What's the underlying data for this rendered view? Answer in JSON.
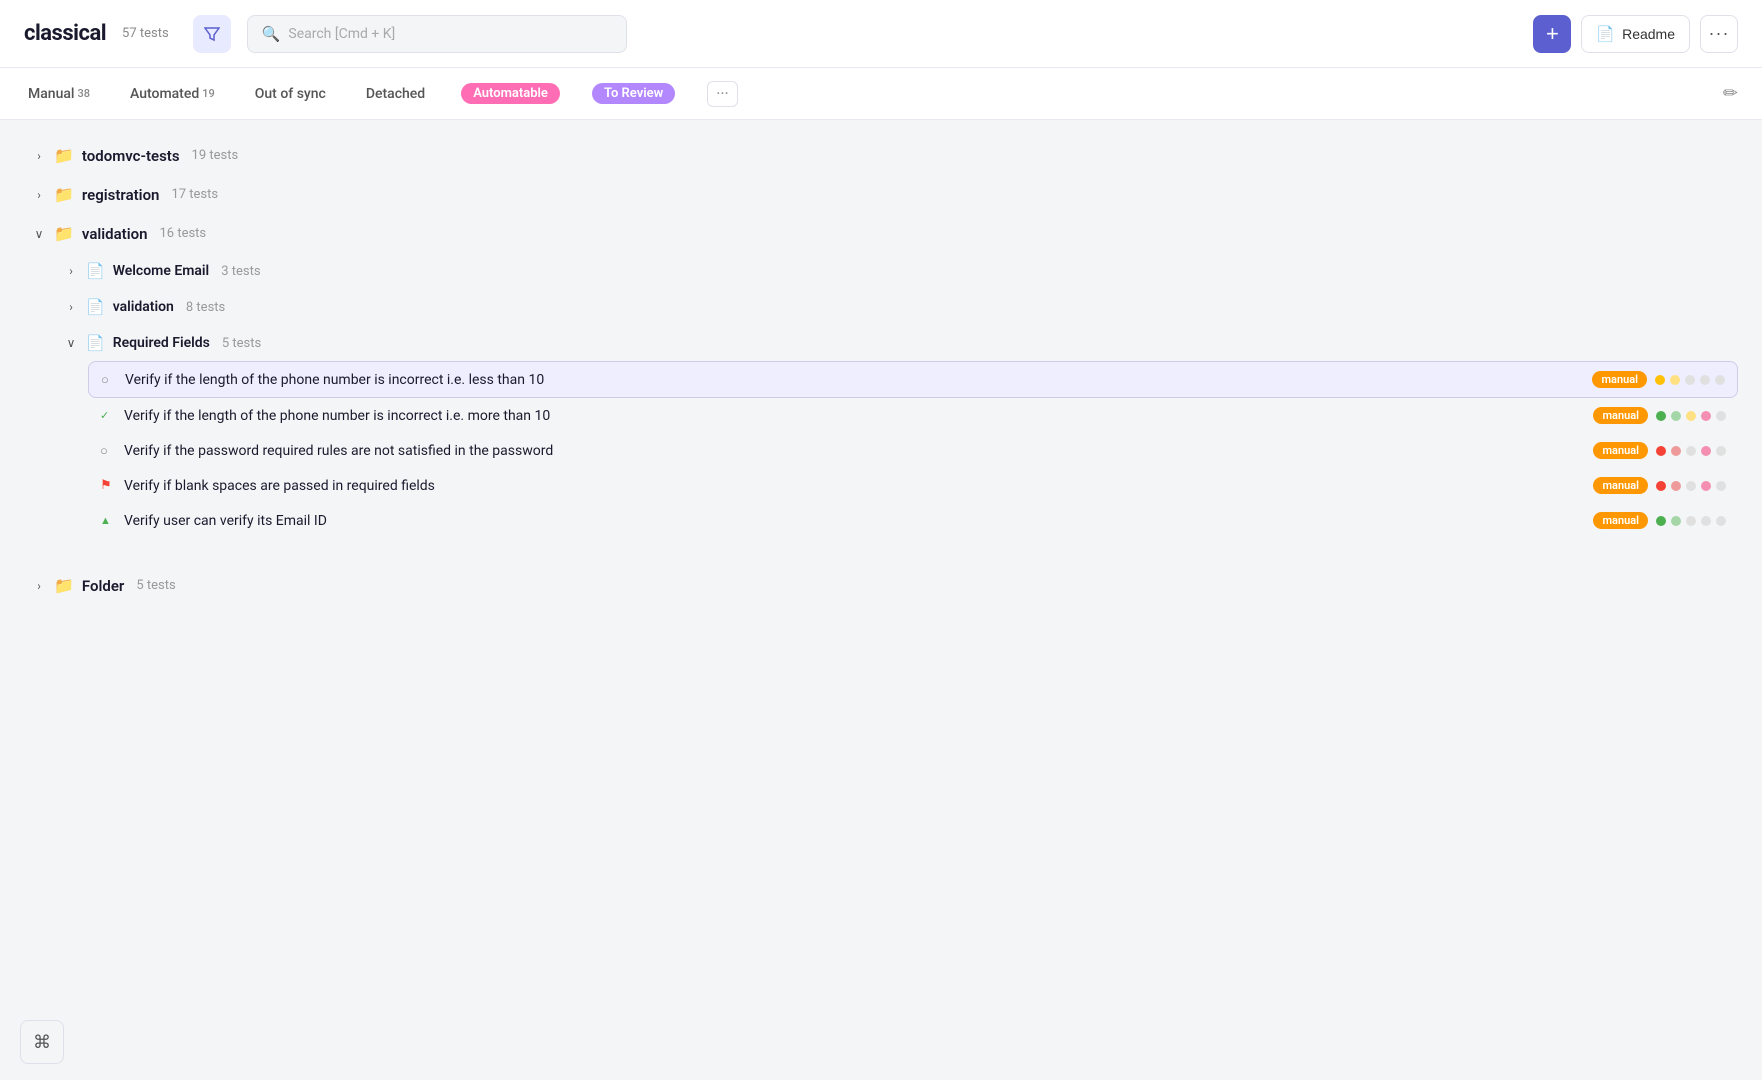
{
  "header": {
    "logo": "classical",
    "tests_count": "57 tests",
    "filter_label": "filter",
    "search_placeholder": "Search [Cmd + K]",
    "add_label": "+",
    "readme_label": "Readme",
    "more_label": "···"
  },
  "tabs": {
    "items": [
      {
        "id": "manual",
        "label": "Manual",
        "count": "38"
      },
      {
        "id": "automated",
        "label": "Automated",
        "count": "19"
      },
      {
        "id": "out-of-sync",
        "label": "Out of sync",
        "count": ""
      },
      {
        "id": "detached",
        "label": "Detached",
        "count": ""
      },
      {
        "id": "automatable",
        "label": "Automatable",
        "badge": "pink"
      },
      {
        "id": "to-review",
        "label": "To Review",
        "badge": "purple"
      },
      {
        "id": "more",
        "label": "···"
      }
    ],
    "edit_icon": "✏"
  },
  "folders": [
    {
      "id": "todomvc-tests",
      "name": "todomvc-tests",
      "count": "19 tests",
      "expanded": false
    },
    {
      "id": "registration",
      "name": "registration",
      "count": "17 tests",
      "expanded": false
    },
    {
      "id": "validation",
      "name": "validation",
      "count": "16 tests",
      "expanded": true,
      "subfolders": [
        {
          "id": "welcome-email",
          "name": "Welcome Email",
          "count": "3 tests",
          "expanded": false
        },
        {
          "id": "validation-sub",
          "name": "validation",
          "count": "8 tests",
          "expanded": false
        },
        {
          "id": "required-fields",
          "name": "Required Fields",
          "count": "5 tests",
          "expanded": true,
          "tests": [
            {
              "id": "t1",
              "name": "Verify if the length of the phone number is incorrect i.e. less than 10",
              "badge": "manual",
              "status_icon": "○",
              "status_color": "#888",
              "selected": true,
              "dots": [
                {
                  "color": "yellow"
                },
                {
                  "color": "yellow-light"
                },
                {
                  "color": "gray"
                },
                {
                  "color": "gray"
                },
                {
                  "color": "gray"
                }
              ]
            },
            {
              "id": "t2",
              "name": "Verify if the length of the phone number is incorrect i.e. more than 10",
              "badge": "manual",
              "status_icon": "✓",
              "status_color": "#4caf50",
              "selected": false,
              "dots": [
                {
                  "color": "green"
                },
                {
                  "color": "green-light"
                },
                {
                  "color": "yellow-light"
                },
                {
                  "color": "pink-light"
                },
                {
                  "color": "gray"
                }
              ]
            },
            {
              "id": "t3",
              "name": "Verify if the password required rules are not satisfied in the password",
              "badge": "manual",
              "status_icon": "○",
              "status_color": "#888",
              "selected": false,
              "dots": [
                {
                  "color": "red"
                },
                {
                  "color": "red-light"
                },
                {
                  "color": "gray"
                },
                {
                  "color": "pink-light"
                },
                {
                  "color": "gray"
                }
              ]
            },
            {
              "id": "t4",
              "name": "Verify if blank spaces are passed in required fields",
              "badge": "manual",
              "status_icon": "⚑",
              "status_color": "#f44336",
              "selected": false,
              "dots": [
                {
                  "color": "red"
                },
                {
                  "color": "red-light"
                },
                {
                  "color": "gray"
                },
                {
                  "color": "pink-light"
                },
                {
                  "color": "gray"
                }
              ]
            },
            {
              "id": "t5",
              "name": "Verify user can verify its Email ID",
              "badge": "manual",
              "status_icon": "▲",
              "status_color": "#4caf50",
              "selected": false,
              "dots": [
                {
                  "color": "green"
                },
                {
                  "color": "green-light"
                },
                {
                  "color": "gray"
                },
                {
                  "color": "gray"
                },
                {
                  "color": "gray"
                }
              ]
            }
          ]
        }
      ]
    },
    {
      "id": "folder",
      "name": "Folder",
      "count": "5 tests",
      "expanded": false
    }
  ],
  "kbd_shortcut": "⌘"
}
